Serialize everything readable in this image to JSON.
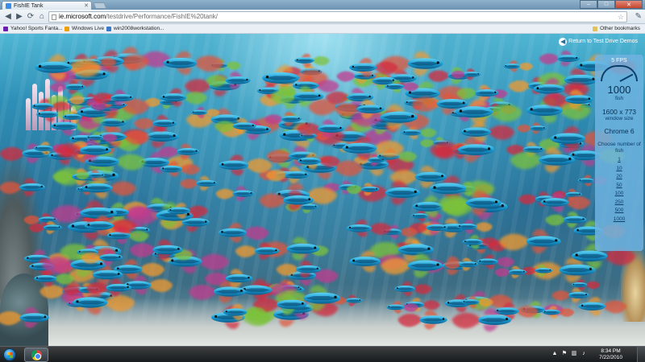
{
  "browser": {
    "tab_title": "FishIE Tank",
    "url_host": "ie.microsoft.com",
    "url_path": "/testdrive/Performance/FishIE%20tank/"
  },
  "bookmarks": [
    {
      "label": "Yahoo! Sports Fanta...",
      "icon": "yahoo-icon",
      "color": "#6a1fb0"
    },
    {
      "label": "Windows Live",
      "icon": "windows-live-icon",
      "color": "#f0a000"
    },
    {
      "label": "win2008workstation...",
      "icon": "page-icon",
      "color": "#3a78c8"
    }
  ],
  "other_bookmarks": "Other bookmarks",
  "page": {
    "return_link": "Return to Test Drive Demos",
    "fps": "5 FPS",
    "fish_count": "1000",
    "fish_label": "fish",
    "window_size": "1600 x 773",
    "window_size_label": "window size",
    "browser_name": "Chrome 6",
    "choose_label": "Choose number of fish",
    "counts": [
      "1",
      "10",
      "20",
      "50",
      "100",
      "250",
      "500",
      "1000"
    ]
  },
  "taskbar": {
    "time": "8:34 PM",
    "date": "7/22/2010"
  },
  "colors": {
    "water": "#2a6f96",
    "panel": "#6eb4e1",
    "fish_body": "#1aa0d8",
    "fin_red": "#d42a3c",
    "fin_orange": "#f29a2e",
    "fin_green": "#7cc23a"
  }
}
